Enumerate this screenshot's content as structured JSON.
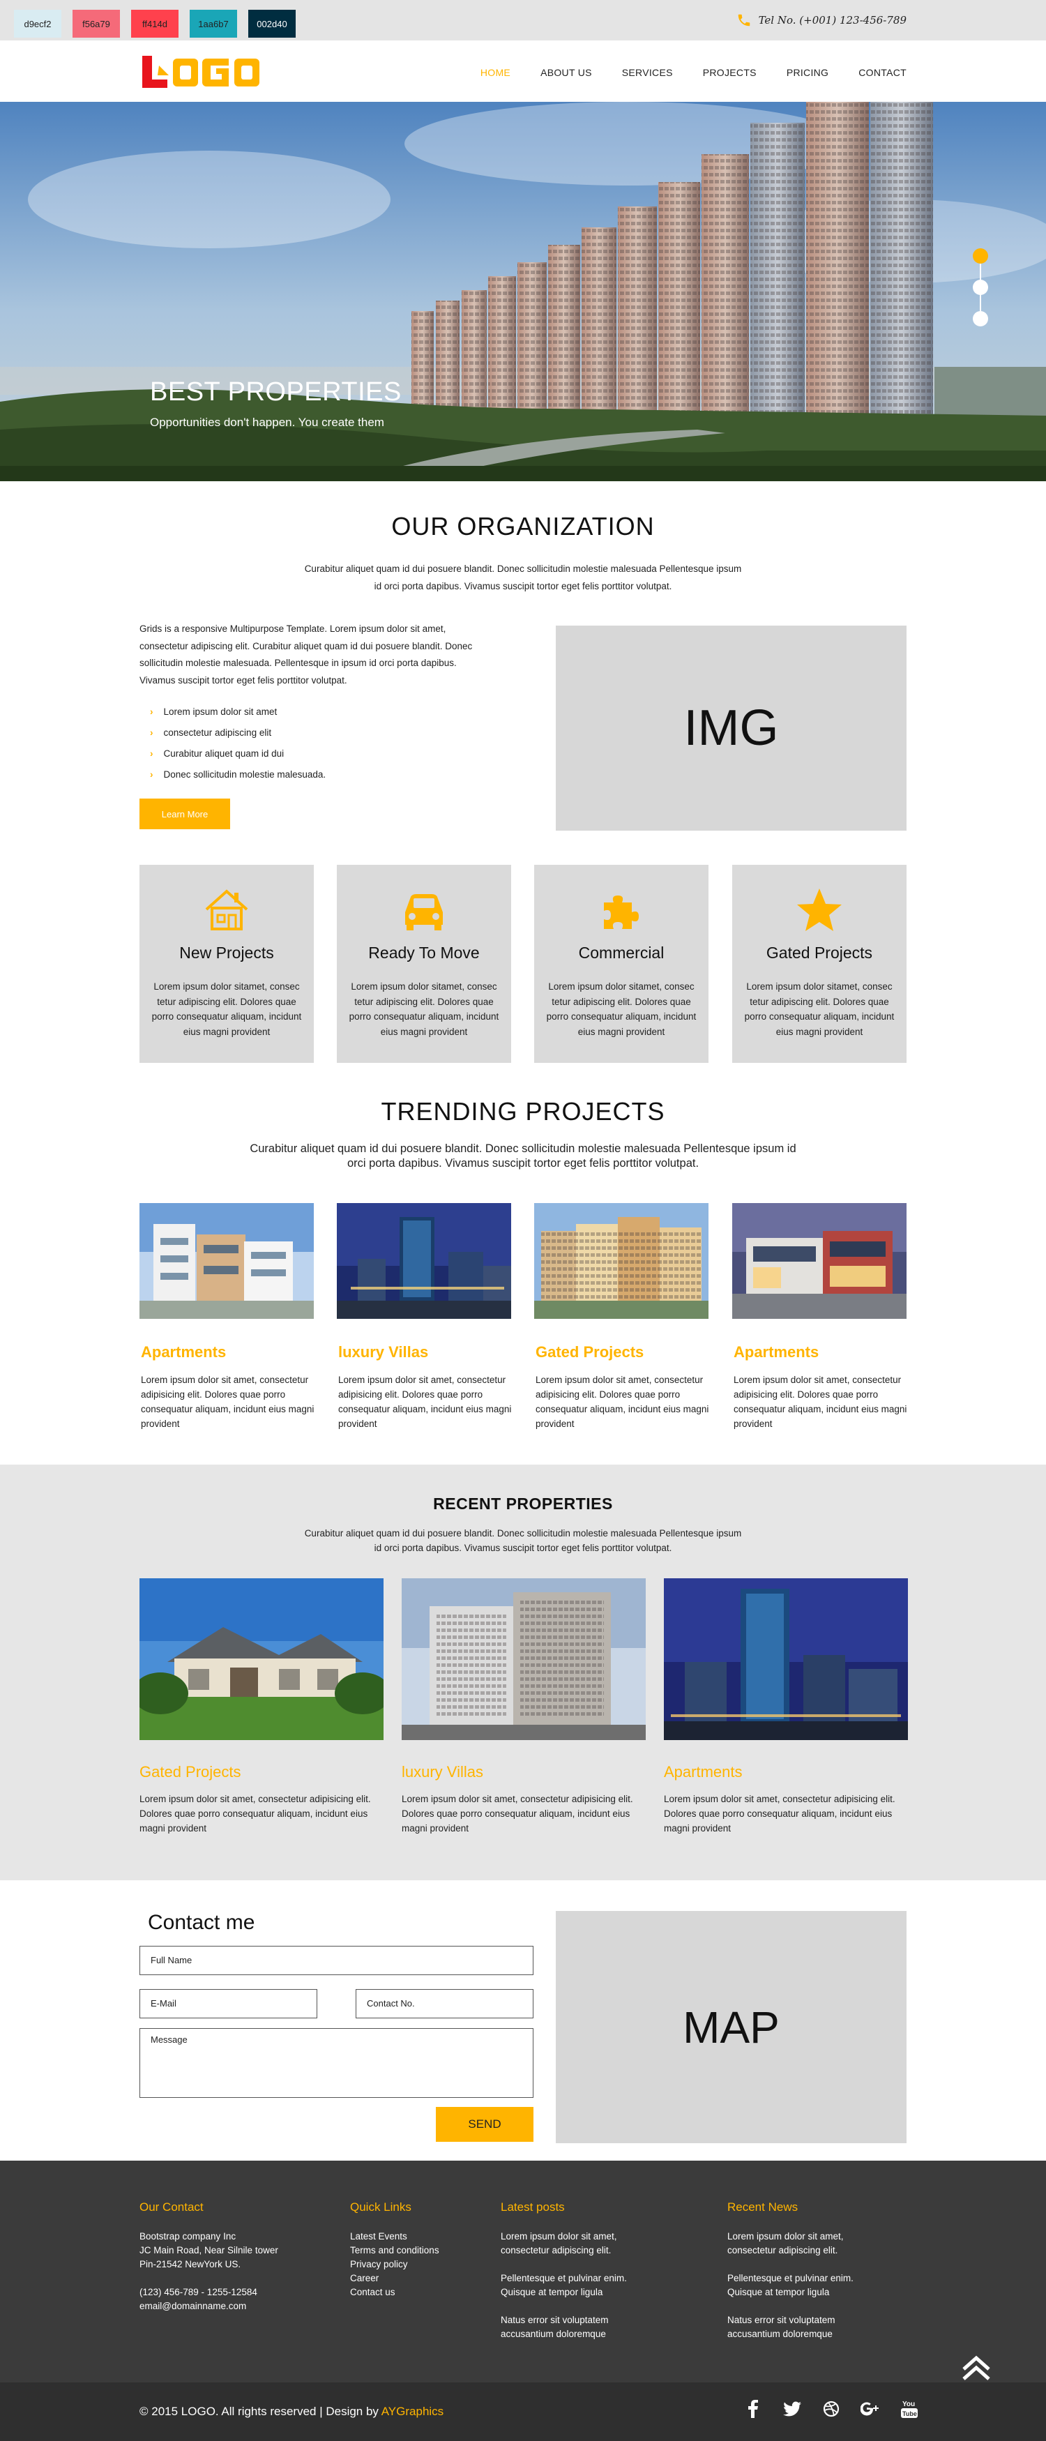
{
  "swatches": [
    {
      "label": "d9ecf2",
      "color": "#d9ecf2",
      "text": "#222222"
    },
    {
      "label": "f56a79",
      "color": "#f56a79",
      "text": "#222222"
    },
    {
      "label": "ff414d",
      "color": "#ff414d",
      "text": "#222222"
    },
    {
      "label": "1aa6b7",
      "color": "#1aa6b7",
      "text": "#222222"
    },
    {
      "label": "002d40",
      "color": "#002d40",
      "text": "#ffffff"
    }
  ],
  "topbar": {
    "phone": "Tel No. (+001) 123-456-789",
    "icon": "phone-icon"
  },
  "header": {
    "logo_text": "LOGO",
    "nav": [
      "HOME",
      "ABOUT US",
      "SERVICES",
      "PROJECTS",
      "PRICING",
      "CONTACT"
    ],
    "active_nav": "HOME"
  },
  "hero": {
    "title": "BEST PROPERTIES",
    "subtitle": "Opportunities don't happen. You create them",
    "slides": 3,
    "active_slide": 1
  },
  "organization": {
    "title": "OUR ORGANIZATION",
    "lead": "Curabitur aliquet quam id dui posuere blandit. Donec sollicitudin molestie malesuada Pellentesque ipsum id orci porta dapibus. Vivamus suscipit tortor eget felis porttitor volutpat.",
    "body": "Grids is a responsive Multipurpose Template. Lorem ipsum dolor sit amet, consectetur adipiscing elit. Curabitur aliquet quam id dui posuere blandit. Donec sollicitudin molestie malesuada. Pellentesque in ipsum id orci porta dapibus. Vivamus suscipit tortor eget felis porttitor volutpat.",
    "list": [
      "Lorem ipsum dolor sit amet",
      "consectetur adipiscing elit",
      "Curabitur aliquet quam id dui",
      "Donec sollicitudin molestie malesuada."
    ],
    "button": "Learn More",
    "image_label": "IMG"
  },
  "features": [
    {
      "title": "New Projects",
      "icon": "house-icon",
      "text": "Lorem ipsum dolor sitamet, consec tetur adipiscing elit. Dolores quae porro consequatur aliquam, incidunt eius magni provident"
    },
    {
      "title": "Ready To Move",
      "icon": "car-icon",
      "text": "Lorem ipsum dolor sitamet, consec tetur adipiscing elit. Dolores quae porro consequatur aliquam, incidunt eius magni provident"
    },
    {
      "title": "Commercial",
      "icon": "puzzle-icon",
      "text": "Lorem ipsum dolor sitamet, consec tetur adipiscing elit. Dolores quae porro consequatur aliquam, incidunt eius magni provident"
    },
    {
      "title": "Gated Projects",
      "icon": "star-icon",
      "text": "Lorem ipsum dolor sitamet, consec tetur adipiscing elit. Dolores quae porro consequatur aliquam, incidunt eius magni provident"
    }
  ],
  "trending": {
    "title": "TRENDING PROJECTS",
    "lead": "Curabitur aliquet quam id dui posuere blandit. Donec sollicitudin molestie malesuada Pellentesque ipsum id orci porta dapibus. Vivamus suscipit tortor eget felis porttitor volutpat.",
    "items": [
      {
        "title": "Apartments",
        "text": "Lorem ipsum dolor sit amet, consectetur adipisicing elit. Dolores quae porro consequatur aliquam, incidunt eius magni provident"
      },
      {
        "title": "luxury Villas",
        "text": "Lorem ipsum dolor sit amet, consectetur adipisicing elit. Dolores quae porro consequatur aliquam, incidunt eius magni provident"
      },
      {
        "title": "Gated Projects",
        "text": "Lorem ipsum dolor sit amet, consectetur adipisicing elit. Dolores quae porro consequatur aliquam, incidunt eius magni provident"
      },
      {
        "title": "Apartments",
        "text": "Lorem ipsum dolor sit amet, consectetur adipisicing elit. Dolores quae porro consequatur aliquam, incidunt eius magni provident"
      }
    ]
  },
  "recent": {
    "title": "RECENT PROPERTIES",
    "lead": "Curabitur aliquet quam id dui posuere blandit. Donec sollicitudin molestie malesuada Pellentesque ipsum id orci porta dapibus. Vivamus suscipit tortor eget felis porttitor volutpat.",
    "items": [
      {
        "title": "Gated Projects",
        "text": "Lorem ipsum dolor sit amet, consectetur adipisicing elit. Dolores quae porro consequatur aliquam, incidunt eius magni provident"
      },
      {
        "title": "luxury Villas",
        "text": "Lorem ipsum dolor sit amet, consectetur adipisicing elit. Dolores quae porro consequatur aliquam, incidunt eius magni provident"
      },
      {
        "title": "Apartments",
        "text": "Lorem ipsum dolor sit amet, consectetur adipisicing elit. Dolores quae porro consequatur aliquam, incidunt eius magni provident"
      }
    ]
  },
  "contact": {
    "title": "Contact me",
    "full_name": "Full Name",
    "email": "E-Mail",
    "phone": "Contact No.",
    "message": "Message",
    "send": "SEND",
    "map_label": "MAP"
  },
  "footer": {
    "our_contact": {
      "title": "Our Contact",
      "lines": [
        "Bootstrap company Inc",
        "JC Main Road, Near Silnile tower",
        "Pin-21542 NewYork US."
      ],
      "phones": "(123) 456-789 - 1255-12584",
      "email": "email@domainname.com"
    },
    "quick_links": {
      "title": "Quick Links",
      "links": [
        "Latest Events",
        "Terms and conditions",
        "Privacy policy",
        "Career",
        "Contact us"
      ]
    },
    "latest_posts": {
      "title": "Latest posts",
      "posts": [
        "Lorem ipsum dolor sit amet, consectetur adipiscing elit.",
        "Pellentesque et pulvinar enim. Quisque at tempor ligula",
        "Natus error sit voluptatem accusantium doloremque"
      ]
    },
    "recent_news": {
      "title": "Recent News",
      "posts": [
        "Lorem ipsum dolor sit amet, consectetur adipiscing elit.",
        "Pellentesque et pulvinar enim. Quisque at tempor ligula",
        "Natus error sit voluptatem accusantium doloremque"
      ]
    },
    "copyright": "© 2015 LOGO. All rights reserved | Design by",
    "designer": "AYGraphics",
    "social": [
      "facebook-icon",
      "twitter-icon",
      "dribbble-icon",
      "google-plus-icon",
      "youtube-icon"
    ]
  },
  "colors": {
    "accent": "#ffb400",
    "footer": "#3b3b3b",
    "bottombar": "#2f2f2f",
    "section_gray": "#e6e6e6",
    "placeholder_gray": "#d7d7d7"
  }
}
